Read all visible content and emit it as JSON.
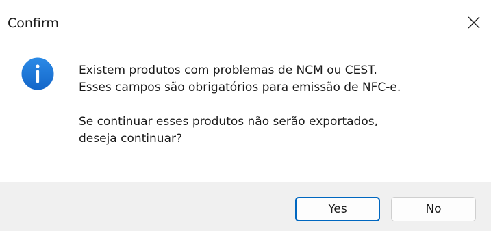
{
  "window": {
    "title": "Confirm",
    "close_icon": "close-icon"
  },
  "dialog": {
    "icon": "info-icon",
    "icon_color": "#1a73d9",
    "message_lines": [
      "Existem produtos com problemas de NCM ou CEST.",
      "Esses campos são obrigatórios para emissão de NFC-e.",
      "Se continuar esses produtos não serão exportados,",
      "deseja continuar?"
    ]
  },
  "buttons": {
    "yes_label": "Yes",
    "no_label": "No",
    "accent_color": "#0067c0"
  }
}
